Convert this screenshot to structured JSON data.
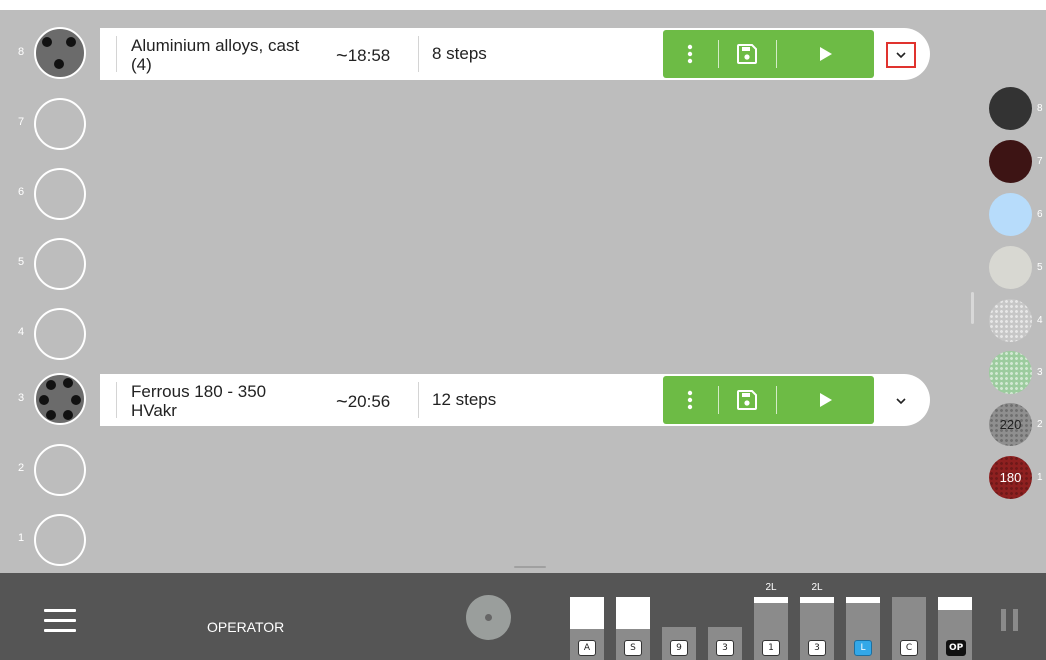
{
  "stations": [
    {
      "num": "8",
      "occupied": true
    },
    {
      "num": "7",
      "occupied": false
    },
    {
      "num": "6",
      "occupied": false
    },
    {
      "num": "5",
      "occupied": false
    },
    {
      "num": "4",
      "occupied": false
    },
    {
      "num": "3",
      "occupied": true
    },
    {
      "num": "2",
      "occupied": false
    },
    {
      "num": "1",
      "occupied": false
    }
  ],
  "programs": [
    {
      "name": "Aluminium alloys, cast (4)",
      "time": "18:58",
      "steps": "8 steps",
      "expand_icon": "chevron-down-icon"
    },
    {
      "name": "Ferrous 180 - 350 HVakr",
      "time": "20:56",
      "steps": "12 steps",
      "expand_icon": "chevron-down-icon"
    }
  ],
  "program_actions": {
    "menu_icon": "more-vert-icon",
    "save_icon": "save-icon",
    "run_icon": "play-icon"
  },
  "time_prefix": "~",
  "discs": [
    {
      "num": "8",
      "color": "#333333",
      "label": ""
    },
    {
      "num": "7",
      "color": "#3d1414",
      "label": ""
    },
    {
      "num": "6",
      "color": "#b7dcfb",
      "label": ""
    },
    {
      "num": "5",
      "color": "#d8d8d2",
      "label": ""
    },
    {
      "num": "4",
      "color": "#c7c7c7",
      "label": ""
    },
    {
      "num": "3",
      "color": "#9ccc9e",
      "label": ""
    },
    {
      "num": "2",
      "color": "#8f8f8f",
      "label": "220"
    },
    {
      "num": "1",
      "color": "#8e2020",
      "label": "180"
    }
  ],
  "bottom": {
    "menu_icon": "hamburger-menu-icon",
    "role": "OPERATOR",
    "tanks": [
      {
        "label": "A",
        "level": 0.5,
        "top": "",
        "style": "normal"
      },
      {
        "label": "S",
        "level": 0.5,
        "top": "",
        "style": "normal"
      },
      {
        "label": "9",
        "level": 0,
        "top": "",
        "style": "normal"
      },
      {
        "label": "3",
        "level": 0,
        "top": "",
        "style": "normal"
      },
      {
        "label": "1",
        "level": 0.1,
        "top": "2L",
        "style": "normal"
      },
      {
        "label": "3",
        "level": 0.1,
        "top": "2L",
        "style": "normal"
      },
      {
        "label": "L",
        "level": 0.1,
        "top": "",
        "style": "blue"
      },
      {
        "label": "C",
        "level": 0,
        "top": "",
        "style": "normal"
      },
      {
        "label": "OP",
        "level": 0.2,
        "top": "",
        "style": "dark"
      }
    ],
    "pause_icon": "pause-icon"
  }
}
